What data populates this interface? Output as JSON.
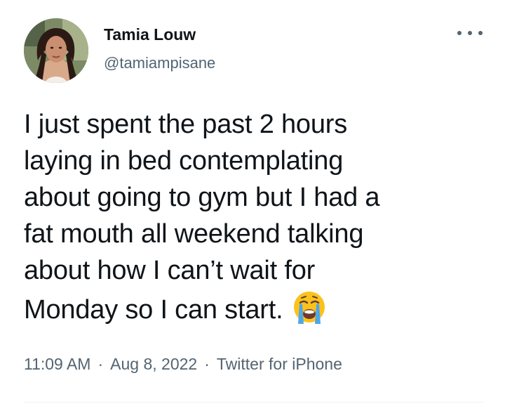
{
  "author": {
    "name": "Tamia Louw",
    "handle": "@tamiampisane"
  },
  "menu": {
    "icon": "more-horizontal-icon"
  },
  "tweet": {
    "lines": [
      "I just spent the past 2 hours",
      "laying in bed contemplating",
      "about going to gym but I had a",
      "fat mouth all weekend talking",
      "about how I can’t wait for",
      "Monday so I can start."
    ],
    "emoji": "loudly-crying-face-icon"
  },
  "meta": {
    "time": "11:09 AM",
    "date": "Aug 8, 2022",
    "source": "Twitter for iPhone",
    "separator": "·"
  },
  "colors": {
    "text": "#0f1419",
    "secondary": "#536471",
    "divider": "#eff3f4",
    "emoji_face": "#fcc21b",
    "emoji_tears": "#4fa6e8"
  }
}
